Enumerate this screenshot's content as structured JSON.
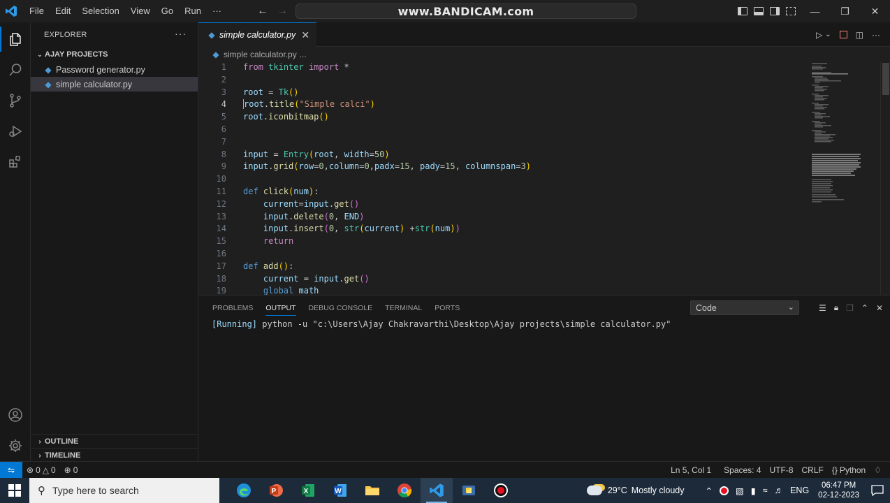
{
  "titlebar": {
    "menu": [
      "File",
      "Edit",
      "Selection",
      "View",
      "Go",
      "Run",
      "···"
    ],
    "search_text": "www.BANDICAM.com"
  },
  "sidebar": {
    "header": "EXPLORER",
    "more": "···",
    "project": "AJAY PROJECTS",
    "files": [
      "Password generator.py",
      "simple calculator.py"
    ],
    "outline": "OUTLINE",
    "timeline": "TIMELINE"
  },
  "editor": {
    "tab_label": "simple calculator.py",
    "breadcrumb": "simple calculator.py",
    "breadcrumb_more": "...",
    "line_numbers": [
      "1",
      "2",
      "3",
      "4",
      "5",
      "6",
      "7",
      "8",
      "9",
      "10",
      "11",
      "12",
      "13",
      "14",
      "15",
      "16",
      "17",
      "18",
      "19"
    ],
    "code_lines": [
      "from tkinter import *",
      "",
      "root = Tk()",
      "root.title(\"Simple calci\")",
      "root.iconbitmap()",
      "",
      "",
      "input = Entry(root, width=50)",
      "input.grid(row=0,column=0,padx=15, pady=15, columnspan=3)",
      "",
      "def click(num):",
      "    current=input.get()",
      "    input.delete(0, END)",
      "    input.insert(0, str(current) +str(num))",
      "    return",
      "",
      "def add():",
      "    current = input.get()",
      "    global math"
    ]
  },
  "panel": {
    "tabs": [
      "PROBLEMS",
      "OUTPUT",
      "DEBUG CONSOLE",
      "TERMINAL",
      "PORTS"
    ],
    "active_tab": "OUTPUT",
    "channel": "Code",
    "output_prefix": "[Running]",
    "output_text": " python -u \"c:\\Users\\Ajay Chakravarthi\\Desktop\\Ajay projects\\simple calculator.py\""
  },
  "statusbar": {
    "errors": "0",
    "warnings": "0",
    "ports": "0",
    "position": "Ln 5, Col 1",
    "spaces": "Spaces: 4",
    "encoding": "UTF-8",
    "eol": "CRLF",
    "language": "Python"
  },
  "taskbar": {
    "search_placeholder": "Type here to search",
    "weather_temp": "29°C",
    "weather_desc": "Mostly cloudy",
    "lang": "ENG",
    "time": "06:47 PM",
    "date": "02-12-2023"
  },
  "colors": {
    "accent": "#0078d4",
    "editor_bg": "#1f1f1f",
    "sidebar_bg": "#181818",
    "taskbar_bg": "#1c2a3a"
  }
}
